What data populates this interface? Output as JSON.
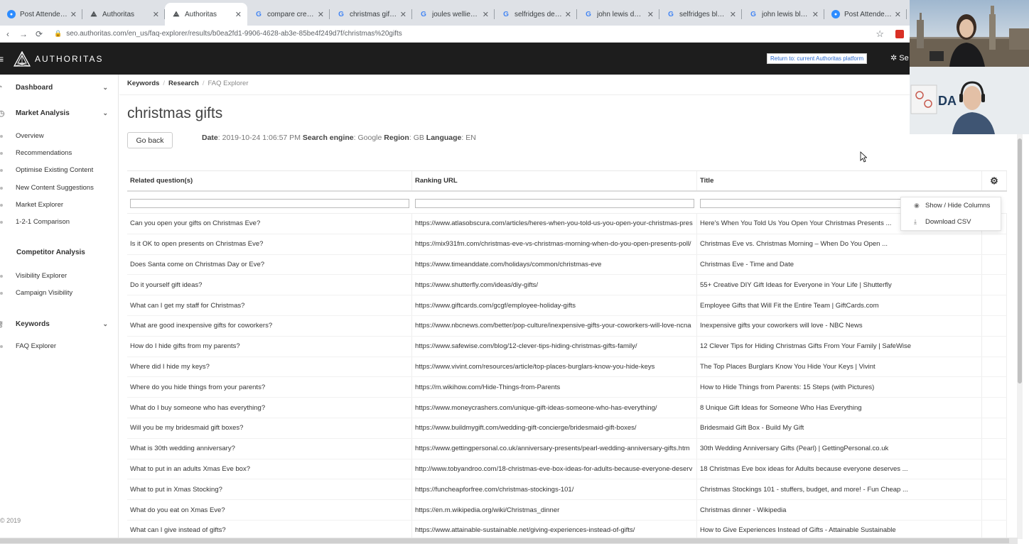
{
  "browser": {
    "tabs": [
      {
        "icon": "zoom",
        "title": "Post Attendee -"
      },
      {
        "icon": "authoritas",
        "title": "Authoritas"
      },
      {
        "icon": "authoritas",
        "title": "Authoritas"
      },
      {
        "icon": "google",
        "title": "compare credit c"
      },
      {
        "icon": "google",
        "title": "christmas gifts jo"
      },
      {
        "icon": "google",
        "title": "joules wellies - G"
      },
      {
        "icon": "google",
        "title": "selfridges deliver"
      },
      {
        "icon": "google",
        "title": "john lewis delive"
      },
      {
        "icon": "google",
        "title": "selfridges black f"
      },
      {
        "icon": "google",
        "title": "john lewis black"
      },
      {
        "icon": "zoom",
        "title": "Post Attendee -"
      }
    ],
    "url": "seo.authoritas.com/en_us/faq-explorer/results/b0ea2fd1-9906-4628-ab3e-85be4f249d7f/christmas%20gifts"
  },
  "header": {
    "brand": "AUTHORITAS",
    "return_label": "Return to: current Authoritas platform",
    "settings_label": "Se"
  },
  "sidebar": {
    "dashboard": "Dashboard",
    "market_analysis": "Market Analysis",
    "market_items": [
      "Overview",
      "Recommendations",
      "Optimise Existing Content",
      "New Content Suggestions",
      "Market Explorer",
      "1-2-1 Comparison"
    ],
    "competitor_analysis": "Competitor Analysis",
    "competitor_items": [
      "Visibility Explorer",
      "Campaign Visibility"
    ],
    "keywords": "Keywords",
    "keyword_items": [
      "FAQ Explorer"
    ],
    "copyright": "© 2019"
  },
  "breadcrumb": [
    "Keywords",
    "Research",
    "FAQ Explorer"
  ],
  "page": {
    "title": "christmas gifts",
    "go_back": "Go back",
    "meta": {
      "date_label": "Date",
      "date": "2019-10-24 1:06:57 PM",
      "engine_label": "Search engine",
      "engine": "Google",
      "region_label": "Region",
      "region": "GB",
      "language_label": "Language",
      "language": "EN"
    }
  },
  "table": {
    "headers": [
      "Related question(s)",
      "Ranking URL",
      "Title"
    ],
    "rows": [
      [
        "Can you open your gifts on Christmas Eve?",
        "https://www.atlasobscura.com/articles/heres-when-you-told-us-you-open-your-christmas-pres",
        "Here's When You Told Us You Open Your Christmas Presents ..."
      ],
      [
        "Is it OK to open presents on Christmas Eve?",
        "https://mix931fm.com/christmas-eve-vs-christmas-morning-when-do-you-open-presents-poll/",
        "Christmas Eve vs. Christmas Morning – When Do You Open ..."
      ],
      [
        "Does Santa come on Christmas Day or Eve?",
        "https://www.timeanddate.com/holidays/common/christmas-eve",
        "Christmas Eve - Time and Date"
      ],
      [
        "Do it yourself gift ideas?",
        "https://www.shutterfly.com/ideas/diy-gifts/",
        "55+ Creative DIY Gift Ideas for Everyone in Your Life | Shutterfly"
      ],
      [
        "What can I get my staff for Christmas?",
        "https://www.giftcards.com/gcgf/employee-holiday-gifts",
        "Employee Gifts that Will Fit the Entire Team | GiftCards.com"
      ],
      [
        "What are good inexpensive gifts for coworkers?",
        "https://www.nbcnews.com/better/pop-culture/inexpensive-gifts-your-coworkers-will-love-ncna",
        "Inexpensive gifts your coworkers will love - NBC News"
      ],
      [
        "How do I hide gifts from my parents?",
        "https://www.safewise.com/blog/12-clever-tips-hiding-christmas-gifts-family/",
        "12 Clever Tips for Hiding Christmas Gifts From Your Family | SafeWise"
      ],
      [
        "Where did I hide my keys?",
        "https://www.vivint.com/resources/article/top-places-burglars-know-you-hide-keys",
        "The Top Places Burglars Know You Hide Your Keys | Vivint"
      ],
      [
        "Where do you hide things from your parents?",
        "https://m.wikihow.com/Hide-Things-from-Parents",
        "How to Hide Things from Parents: 15 Steps (with Pictures)"
      ],
      [
        "What do I buy someone who has everything?",
        "https://www.moneycrashers.com/unique-gift-ideas-someone-who-has-everything/",
        "8 Unique Gift Ideas for Someone Who Has Everything"
      ],
      [
        "Will you be my bridesmaid gift boxes?",
        "https://www.buildmygift.com/wedding-gift-concierge/bridesmaid-gift-boxes/",
        "Bridesmaid Gift Box - Build My Gift"
      ],
      [
        "What is 30th wedding anniversary?",
        "https://www.gettingpersonal.co.uk/anniversary-presents/pearl-wedding-anniversary-gifts.htm",
        "30th Wedding Anniversary Gifts (Pearl) | GettingPersonal.co.uk"
      ],
      [
        "What to put in an adults Xmas Eve box?",
        "http://www.tobyandroo.com/18-christmas-eve-box-ideas-for-adults-because-everyone-deserv",
        "18 Christmas Eve box ideas for Adults because everyone deserves ..."
      ],
      [
        "What to put in Xmas Stocking?",
        "https://funcheapforfree.com/christmas-stockings-101/",
        "Christmas Stockings 101 - stuffers, budget, and more! - Fun Cheap ..."
      ],
      [
        "What do you eat on Xmas Eve?",
        "https://en.m.wikipedia.org/wiki/Christmas_dinner",
        "Christmas dinner - Wikipedia"
      ],
      [
        "What can I give instead of gifts?",
        "https://www.attainable-sustainable.net/giving-experiences-instead-of-gifts/",
        "How to Give Experiences Instead of Gifts - Attainable Sustainable"
      ]
    ]
  },
  "column_menu": {
    "show_hide": "Show / Hide Columns",
    "download": "Download CSV"
  },
  "video": {
    "tile2_text": "DA"
  }
}
